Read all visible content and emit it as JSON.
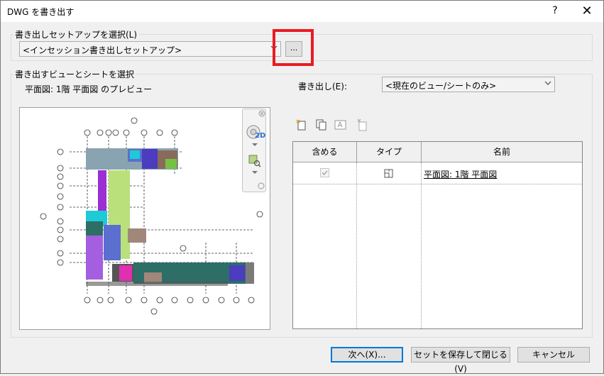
{
  "window": {
    "title": "DWG を書き出す",
    "help_glyph": "?",
    "close_glyph": "✕"
  },
  "setup_group": {
    "label": "書き出しセットアップを選択(L)",
    "selected_value": "<インセッション書き出しセットアップ>",
    "browse_button_label": "..."
  },
  "views_group": {
    "label": "書き出すビューとシートを選択",
    "preview_caption": "平面図: 1階 平面図 のプレビュー",
    "export_label": "書き出し(E):",
    "export_value": "<現在のビュー/シートのみ>",
    "nav_2d_label": "2D",
    "toolbar_icons": [
      "new-set-icon",
      "duplicate-set-icon",
      "rename-set-icon",
      "delete-set-icon"
    ],
    "table": {
      "columns": [
        "含める",
        "タイプ",
        "名前"
      ],
      "rows": [
        {
          "include": true,
          "type_icon": "floor-plan-icon",
          "name": "平面図: 1階 平面図"
        }
      ]
    }
  },
  "buttons": {
    "next": "次へ(X)...",
    "save_close": "セットを保存して閉じる(V)",
    "cancel": "キャンセル"
  },
  "colors": {
    "highlight_frame": "#e81b24",
    "default_button_border": "#0078d7"
  }
}
